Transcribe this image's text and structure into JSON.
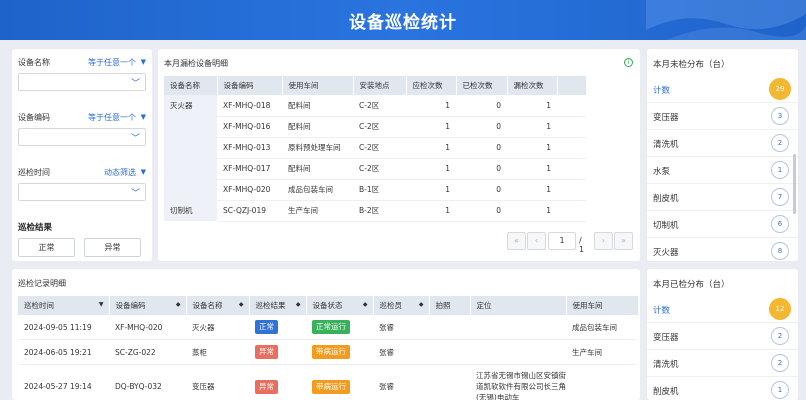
{
  "header": {
    "title": "设备巡检统计"
  },
  "colors": {
    "header_bg": "#1e63c9",
    "accent": "#2a6dd6",
    "badge_orange": "#f3b731",
    "tag_blue": "#2f73d6",
    "tag_red": "#e86f5f",
    "tag_green": "#39b05a",
    "tag_orange": "#f39b1f"
  },
  "filters": {
    "device_name": {
      "label": "设备名称",
      "mode": "等于任意一个"
    },
    "device_code": {
      "label": "设备编码",
      "mode": "等于任意一个"
    },
    "inspect_time": {
      "label": "巡检时间",
      "mode": "动态筛选"
    },
    "result": {
      "title": "巡检结果",
      "options": [
        "正常",
        "异常"
      ]
    }
  },
  "monthly": {
    "title": "本月漏检设备明细",
    "columns": [
      "设备名称",
      "设备编码",
      "使用车间",
      "安装地点",
      "应检次数",
      "已检次数",
      "漏检次数"
    ],
    "groups": [
      {
        "name": "灭火器",
        "rows": [
          [
            "XF-MHQ-018",
            "配料间",
            "C-2区",
            "1",
            "0",
            "1"
          ],
          [
            "XF-MHQ-016",
            "配料间",
            "C-2区",
            "1",
            "0",
            "1"
          ],
          [
            "XF-MHQ-013",
            "原料预处理车间",
            "C-2区",
            "1",
            "0",
            "1"
          ],
          [
            "XF-MHQ-017",
            "配料间",
            "C-2区",
            "1",
            "0",
            "1"
          ],
          [
            "XF-MHQ-020",
            "成品包装车间",
            "B-1区",
            "1",
            "0",
            "1"
          ]
        ]
      },
      {
        "name": "切制机",
        "rows": [
          [
            "SC-QZJ-019",
            "生产车间",
            "B-2区",
            "1",
            "0",
            "1"
          ]
        ]
      }
    ],
    "pager": {
      "first": "«",
      "prev": "‹",
      "current": "1",
      "total": "/ 1",
      "next": "›",
      "last": "»"
    }
  },
  "unchecked": {
    "title": "本月未检分布（台）",
    "head": {
      "label": "计数",
      "count": "29"
    },
    "items": [
      {
        "label": "变压器",
        "count": "3"
      },
      {
        "label": "清洗机",
        "count": "2"
      },
      {
        "label": "水泵",
        "count": "1"
      },
      {
        "label": "削皮机",
        "count": "7"
      },
      {
        "label": "切制机",
        "count": "6"
      },
      {
        "label": "灭火器",
        "count": "8"
      }
    ]
  },
  "checked": {
    "title": "本月已检分布（台）",
    "head": {
      "label": "计数",
      "count": "12"
    },
    "items": [
      {
        "label": "变压器",
        "count": "2"
      },
      {
        "label": "清洗机",
        "count": "2"
      },
      {
        "label": "削皮机",
        "count": "1"
      }
    ]
  },
  "records": {
    "title": "巡检记录明细",
    "columns": [
      "巡检时间",
      "设备编码",
      "设备名称",
      "巡检结果",
      "设备状态",
      "巡检员",
      "拍照",
      "定位",
      "使用车间"
    ],
    "rows": [
      {
        "time": "2024-09-05 11:19",
        "code": "XF-MHQ-020",
        "name": "灭火器",
        "result": "正常",
        "result_color": "#2f73d6",
        "status": "正常运行",
        "status_color": "#39b05a",
        "inspector": "张睿",
        "photo": "",
        "location": "",
        "workshop": "成品包装车间"
      },
      {
        "time": "2024-06-05 19:21",
        "code": "SC-ZG-022",
        "name": "蒸柜",
        "result": "异常",
        "result_color": "#e86f5f",
        "status": "带病运行",
        "status_color": "#f39b1f",
        "inspector": "张睿",
        "photo": "",
        "location": "",
        "workshop": "生产车间"
      },
      {
        "time": "2024-05-27 19:14",
        "code": "DQ-BYQ-032",
        "name": "变压器",
        "result": "异常",
        "result_color": "#e86f5f",
        "status": "带病运行",
        "status_color": "#f39b1f",
        "inspector": "张睿",
        "photo": "",
        "location": "江苏省无锡市锡山区安镇街道凯软软件有限公司长三角(无锡)电动车",
        "workshop": ""
      }
    ]
  }
}
